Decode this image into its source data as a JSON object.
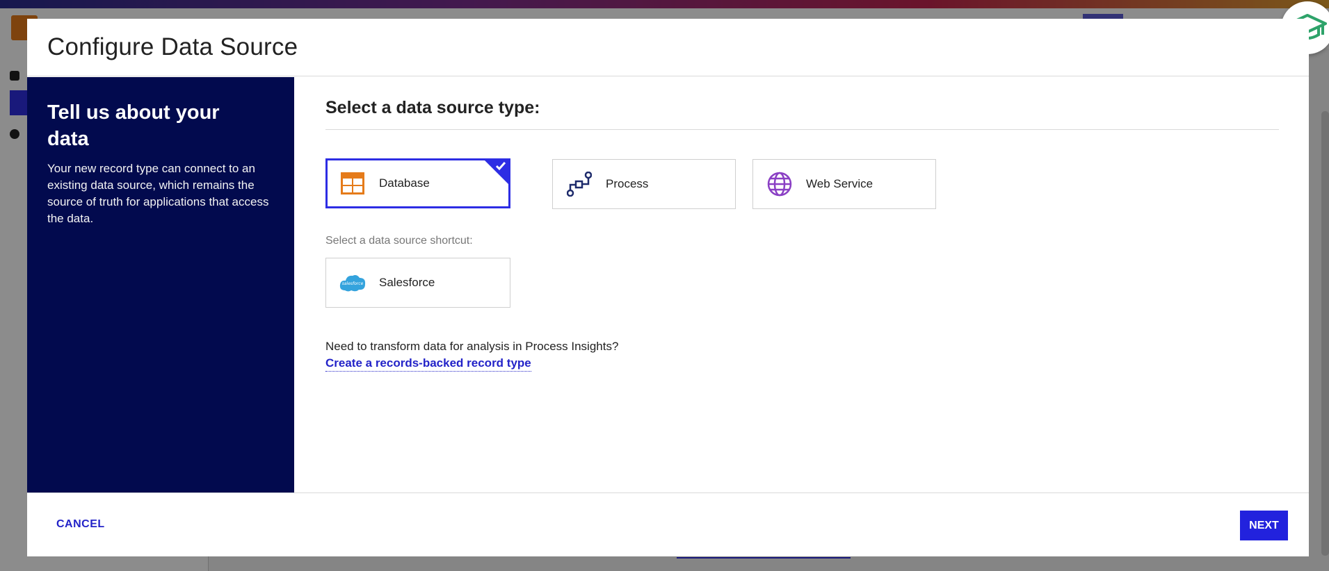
{
  "dialog": {
    "title": "Configure Data Source"
  },
  "left_panel": {
    "heading": "Tell us about your data",
    "description": "Your new record type can connect to an existing data source, which remains the source of truth for applications that access the data."
  },
  "source_types": {
    "title": "Select a data source type:",
    "options": [
      {
        "label": "Database",
        "icon": "database-table-icon",
        "selected": true
      },
      {
        "label": "Process",
        "icon": "process-flow-icon",
        "selected": false
      },
      {
        "label": "Web Service",
        "icon": "globe-icon",
        "selected": false
      }
    ]
  },
  "shortcuts": {
    "label": "Select a data source shortcut:",
    "options": [
      {
        "label": "Salesforce",
        "icon": "salesforce-cloud-icon"
      }
    ]
  },
  "transform": {
    "prompt": "Need to transform data for analysis in Process Insights?",
    "link": "Create a records-backed record type"
  },
  "footer": {
    "cancel_label": "CANCEL",
    "next_label": "NEXT"
  },
  "colors": {
    "panel_bg": "#020a4e",
    "accent": "#2d2de4",
    "database_icon": "#e57b1a",
    "process_icon": "#1d2a6b",
    "globe_icon": "#8a3fc4",
    "help_icon": "#2ea36a"
  }
}
